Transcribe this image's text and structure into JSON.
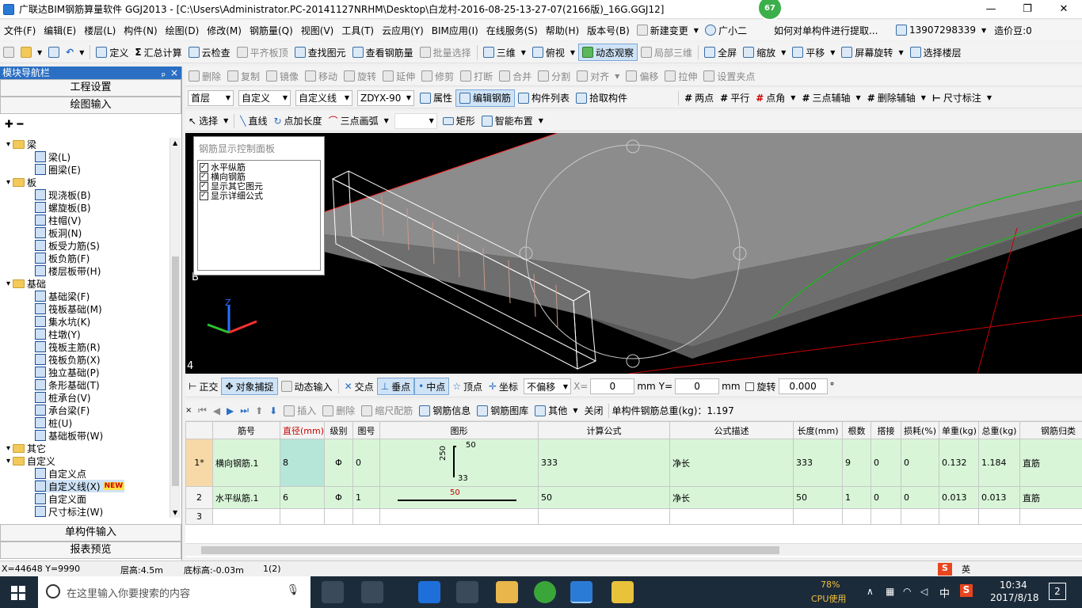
{
  "title": {
    "text": "广联达BIM钢筋算量软件 GGJ2013 - [C:\\Users\\Administrator.PC-20141127NRHM\\Desktop\\白龙村-2016-08-25-13-27-07(2166版)_16G.GGJ12]",
    "badge": "67",
    "min": "—",
    "max": "❐",
    "close": "✕"
  },
  "menu": {
    "items": [
      "文件(F)",
      "编辑(E)",
      "楼层(L)",
      "构件(N)",
      "绘图(D)",
      "修改(M)",
      "钢筋量(Q)",
      "视图(V)",
      "工具(T)",
      "云应用(Y)",
      "BIM应用(I)",
      "在线服务(S)",
      "帮助(H)",
      "版本号(B)"
    ],
    "new_change": "新建变更",
    "assistant": "广小二",
    "question": "如何对单构件进行提取...",
    "phone": "13907298339",
    "price": "造价豆:0"
  },
  "tb1": {
    "define": "定义",
    "sum": "汇总计算",
    "cloud_check": "云检查",
    "align_top": "平齐板顶",
    "find": "查找图元",
    "view_rebar": "查看钢筋量",
    "batch": "批量选择",
    "three_d": "三维",
    "topview": "俯视",
    "dynamic": "动态观察",
    "local3d": "局部三维",
    "fullscreen": "全屏",
    "zoom": "缩放",
    "pan": "平移",
    "rotate_screen": "屏幕旋转",
    "select_floor": "选择楼层"
  },
  "tb2": {
    "delete": "删除",
    "copy": "复制",
    "mirror": "镜像",
    "move": "移动",
    "rotate": "旋转",
    "extend": "延伸",
    "trim": "修剪",
    "break": "打断",
    "merge": "合并",
    "split": "分割",
    "align": "对齐",
    "offset": "偏移",
    "stretch": "拉伸",
    "set_node": "设置夹点"
  },
  "tb3": {
    "floor": "首层",
    "type1": "自定义",
    "type2": "自定义线",
    "name": "ZDYX-90",
    "props": "属性",
    "edit_rebar": "编辑钢筋",
    "list": "构件列表",
    "pick": "拾取构件",
    "two_point": "两点",
    "parallel": "平行",
    "point_angle": "点角",
    "three_point_axis": "三点辅轴",
    "delete_axis": "删除辅轴",
    "dimension": "尺寸标注"
  },
  "tb4": {
    "select": "选择",
    "line": "直线",
    "point_len": "点加长度",
    "three_arc": "三点画弧",
    "rect": "矩形",
    "smart": "智能布置"
  },
  "nav": {
    "header": "模块导航栏",
    "pin": "ₚ",
    "close": "×",
    "project": "工程设置",
    "drawing": "绘图输入",
    "single": "单构件输入",
    "report": "报表预览"
  },
  "tree": [
    {
      "t": "梁",
      "lvl": 0
    },
    {
      "t": "梁(L)",
      "lvl": 1
    },
    {
      "t": "圈梁(E)",
      "lvl": 1
    },
    {
      "t": "板",
      "lvl": 0
    },
    {
      "t": "现浇板(B)",
      "lvl": 1
    },
    {
      "t": "螺旋板(B)",
      "lvl": 1
    },
    {
      "t": "柱帽(V)",
      "lvl": 1
    },
    {
      "t": "板洞(N)",
      "lvl": 1
    },
    {
      "t": "板受力筋(S)",
      "lvl": 1
    },
    {
      "t": "板负筋(F)",
      "lvl": 1
    },
    {
      "t": "楼层板带(H)",
      "lvl": 1
    },
    {
      "t": "基础",
      "lvl": 0
    },
    {
      "t": "基础梁(F)",
      "lvl": 1
    },
    {
      "t": "筏板基础(M)",
      "lvl": 1
    },
    {
      "t": "集水坑(K)",
      "lvl": 1
    },
    {
      "t": "柱墩(Y)",
      "lvl": 1
    },
    {
      "t": "筏板主筋(R)",
      "lvl": 1
    },
    {
      "t": "筏板负筋(X)",
      "lvl": 1
    },
    {
      "t": "独立基础(P)",
      "lvl": 1
    },
    {
      "t": "条形基础(T)",
      "lvl": 1
    },
    {
      "t": "桩承台(V)",
      "lvl": 1
    },
    {
      "t": "承台梁(F)",
      "lvl": 1
    },
    {
      "t": "桩(U)",
      "lvl": 1
    },
    {
      "t": "基础板带(W)",
      "lvl": 1
    },
    {
      "t": "其它",
      "lvl": 0
    },
    {
      "t": "自定义",
      "lvl": 0
    },
    {
      "t": "自定义点",
      "lvl": 1
    },
    {
      "t": "自定义线(X)",
      "lvl": 1
    },
    {
      "t": "自定义面",
      "lvl": 1
    },
    {
      "t": "尺寸标注(W)",
      "lvl": 1
    }
  ],
  "tree_new": "NEW",
  "ctrl": {
    "title": "钢筋显示控制面板",
    "items": [
      "水平纵筋",
      "横向钢筋",
      "显示其它图元",
      "显示详细公式"
    ]
  },
  "canvas": {
    "axis_z": "Z",
    "label_4": "4",
    "label_b": "B"
  },
  "snap": {
    "ortho": "正交",
    "snap": "对象捕捉",
    "dyn_input": "动态输入",
    "intersect": "交点",
    "perp": "垂点",
    "mid": "中点",
    "vertex": "顶点",
    "coord": "坐标",
    "offset": "不偏移",
    "x_label": "X=",
    "x": "0",
    "mm": "mm",
    "y_label": "Y=",
    "y": "0",
    "rotate": "旋转",
    "rot_val": "0.000",
    "deg": "°"
  },
  "gridtb": {
    "insert": "插入",
    "delete": "删除",
    "scale": "缩尺配筋",
    "info": "钢筋信息",
    "lib": "钢筋图库",
    "other": "其他",
    "close": "关闭",
    "total": "单构件钢筋总重(kg)：1.197"
  },
  "table": {
    "headers": [
      "筋号",
      "直径(mm)",
      "级别",
      "图号",
      "图形",
      "计算公式",
      "公式描述",
      "长度(mm)",
      "根数",
      "搭接",
      "损耗(%)",
      "单重(kg)",
      "总重(kg)",
      "钢筋归类"
    ],
    "rows": [
      {
        "idx": "1*",
        "cells": [
          "横向钢筋.1",
          "8",
          "Φ",
          "0",
          "",
          "333",
          "净长",
          "333",
          "9",
          "0",
          "0",
          "0.132",
          "1.184",
          "直筋"
        ],
        "shape_top": "50",
        "shape_left": "250",
        "shape_bottom": "33"
      },
      {
        "idx": "2",
        "cells": [
          "水平纵筋.1",
          "6",
          "Φ",
          "1",
          "",
          "50",
          "净长",
          "50",
          "1",
          "0",
          "0",
          "0.013",
          "0.013",
          "直筋"
        ],
        "shape_mid": "50"
      },
      {
        "idx": "3",
        "cells": [
          "",
          "",
          "",
          "",
          "",
          "",
          "",
          "",
          "",
          "",
          "",
          "",
          "",
          ""
        ]
      }
    ]
  },
  "status": {
    "xy": "X=44648 Y=9990",
    "floor_h": "层高:4.5m",
    "base_h": "底标高:-0.03m",
    "count": "1(2)"
  },
  "taskbar": {
    "search": "在这里输入你要搜索的内容",
    "cpu": "78%",
    "cpu_label": "CPU使用",
    "ime": "中",
    "time": "10:34",
    "date": "2017/8/18",
    "notif": "2",
    "ime2": "英"
  }
}
